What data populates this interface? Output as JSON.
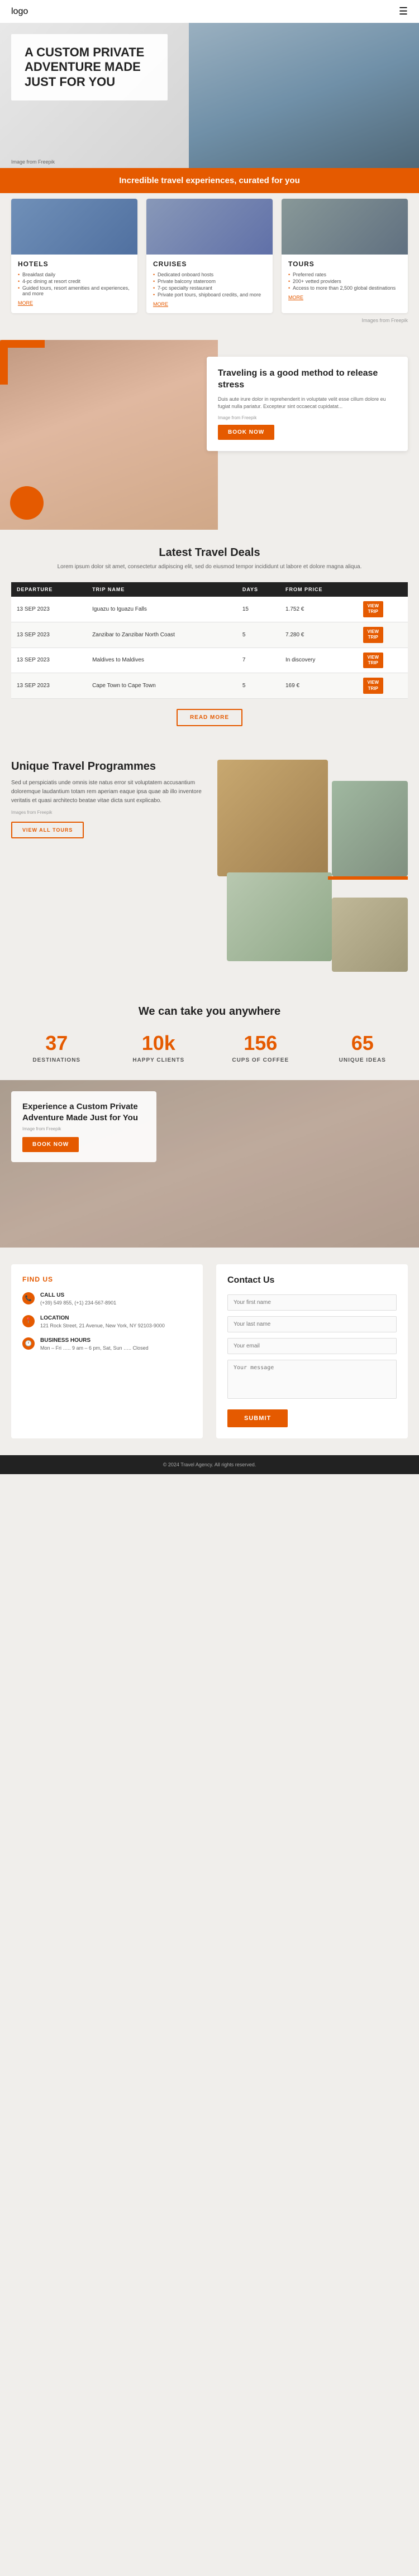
{
  "header": {
    "logo": "logo",
    "menu_icon": "☰"
  },
  "hero": {
    "title": "A CUSTOM PRIVATE ADVENTURE MADE JUST FOR YOU",
    "image_credit": "Image from Freepik",
    "orange_bar": "Incredible travel experiences, curated for you"
  },
  "services": {
    "label": "Images from Freepik",
    "cards": [
      {
        "id": "hotels",
        "title": "HOTELS",
        "features": [
          "Breakfast daily",
          "4-pc dining at resort credit",
          "Guided tours, resort amenities and experiences, and more"
        ],
        "more_label": "MORE"
      },
      {
        "id": "cruises",
        "title": "CRUISES",
        "features": [
          "Dedicated onboard hosts",
          "Private balcony stateroom",
          "7-pc specialty restaurant",
          "Private port tours, shipboard credits, and more"
        ],
        "more_label": "MORE"
      },
      {
        "id": "tours",
        "title": "TOURS",
        "features": [
          "Preferred rates",
          "200+ vetted providers",
          "Access to more than 2,500 global destinations"
        ],
        "more_label": "MORE"
      }
    ]
  },
  "travel_stress": {
    "title": "Traveling is a good method to release stress",
    "description": "Duis aute irure dolor in reprehenderit in voluptate velit esse cillum dolore eu fugiat nulla pariatur. Excepteur sint occaecat cupidatat...",
    "image_credit": "Image from Freepik",
    "book_now": "BOOK NOW"
  },
  "latest_deals": {
    "title": "Latest Travel Deals",
    "subtitle": "Lorem ipsum dolor sit amet, consectetur adipiscing elit, sed do eiusmod tempor incididunt ut labore et dolore magna aliqua.",
    "columns": [
      "DEPARTURE",
      "TRIP NAME",
      "DAYS",
      "FROM PRICE",
      ""
    ],
    "rows": [
      {
        "departure": "13 SEP 2023",
        "trip": "Iguazu to Iguazu Falls",
        "days": "15",
        "price": "1.752 €",
        "btn1": "VIEW",
        "btn2": "TRIP"
      },
      {
        "departure": "13 SEP 2023",
        "trip": "Zanzibar to Zanzibar North Coast",
        "days": "5",
        "price": "7.280 €",
        "btn1": "VIEW",
        "btn2": "TRIP"
      },
      {
        "departure": "13 SEP 2023",
        "trip": "Maldives to Maldives",
        "days": "7",
        "price": "In discovery",
        "btn1": "VIEW",
        "btn2": "TRIP"
      },
      {
        "departure": "13 SEP 2023",
        "trip": "Cape Town to Cape Town",
        "days": "5",
        "price": "169 €",
        "btn1": "VIEW",
        "btn2": "TRIP"
      }
    ],
    "read_more": "READ MORE"
  },
  "unique_programmes": {
    "title": "Unique Travel Programmes",
    "description": "Sed ut perspiciatis unde omnis iste natus error sit voluptatem accusantium doloremque laudantium totam rem aperiam eaque ipsa quae ab illo inventore veritatis et quasi architecto beatae vitae dicta sunt explicabo.",
    "image_credit": "Images from Freepik",
    "view_tours": "VIEW ALL TOURS"
  },
  "stats": {
    "title": "We can take you anywhere",
    "items": [
      {
        "number": "37",
        "label": "DESTINATIONS"
      },
      {
        "number": "10k",
        "label": "HAPPY CLIENTS"
      },
      {
        "number": "156",
        "label": "CUPS OF COFFEE"
      },
      {
        "number": "65",
        "label": "UNIQUE IDEAS"
      }
    ]
  },
  "experience": {
    "title": "Experience a Custom Private Adventure Made Just for You",
    "image_credit": "Image from Freepik",
    "book_now": "BOOK NOW"
  },
  "contact": {
    "left": {
      "title": "FIND US",
      "call_us": {
        "label": "CALL US",
        "value": "(+39) 549 855, (+1) 234-567-8901"
      },
      "location": {
        "label": "LOCATION",
        "value": "121 Rock Street, 21 Avenue, New York, NY 92103-9000"
      },
      "hours": {
        "label": "BUSINESS HOURS",
        "value": "Mon – Fri ….. 9 am – 6 pm, Sat, Sun ….. Closed"
      }
    },
    "right": {
      "title": "Contact Us",
      "fields": [
        {
          "placeholder": "Your first name",
          "type": "text"
        },
        {
          "placeholder": "Your last name",
          "type": "text"
        },
        {
          "placeholder": "Your email",
          "type": "email"
        },
        {
          "placeholder": "Your message",
          "type": "textarea"
        }
      ],
      "submit_label": "SUBMIT"
    }
  },
  "footer": {
    "text": "© 2024 Travel Agency. All rights reserved."
  }
}
